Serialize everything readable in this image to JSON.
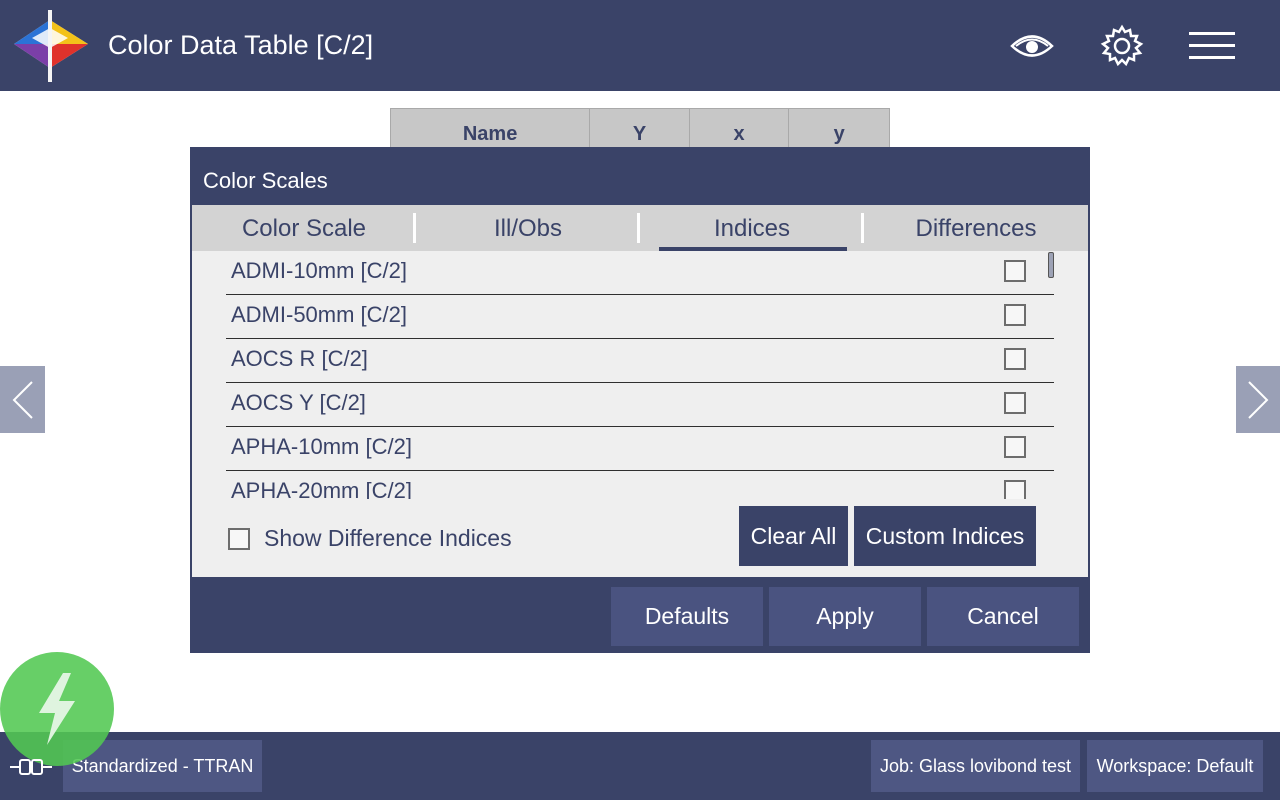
{
  "header": {
    "title": "Color Data Table [C/2]",
    "icons": [
      "eye-icon",
      "gear-icon",
      "hamburger-menu-icon"
    ]
  },
  "background_table": {
    "columns": [
      "Name",
      "Y",
      "x",
      "y"
    ]
  },
  "dialog": {
    "title": "Color Scales",
    "tabs": [
      {
        "label": "Color Scale",
        "selected": false
      },
      {
        "label": "Ill/Obs",
        "selected": false
      },
      {
        "label": "Indices",
        "selected": true
      },
      {
        "label": "Differences",
        "selected": false
      }
    ],
    "items": [
      {
        "label": "ADMI-10mm [C/2]",
        "checked": false
      },
      {
        "label": "ADMI-50mm [C/2]",
        "checked": false
      },
      {
        "label": "AOCS R [C/2]",
        "checked": false
      },
      {
        "label": "AOCS Y [C/2]",
        "checked": false
      },
      {
        "label": "APHA-10mm [C/2]",
        "checked": false
      },
      {
        "label": "APHA-20mm [C/2]",
        "checked": false
      }
    ],
    "show_difference_indices": {
      "label": "Show Difference Indices",
      "checked": false
    },
    "clear_all_label": "Clear All",
    "custom_indices_label": "Custom Indices",
    "defaults_label": "Defaults",
    "apply_label": "Apply",
    "cancel_label": "Cancel"
  },
  "footer": {
    "status": "Standardized - TTRAN",
    "job": "Job: Glass lovibond test",
    "workspace": "Workspace: Default"
  },
  "colors": {
    "primary": "#3a4368",
    "tab_bar": "#d3d3d3",
    "body_bg": "#efefef",
    "status_green": "#52c852",
    "side_arrow": "#9aa0b6"
  }
}
